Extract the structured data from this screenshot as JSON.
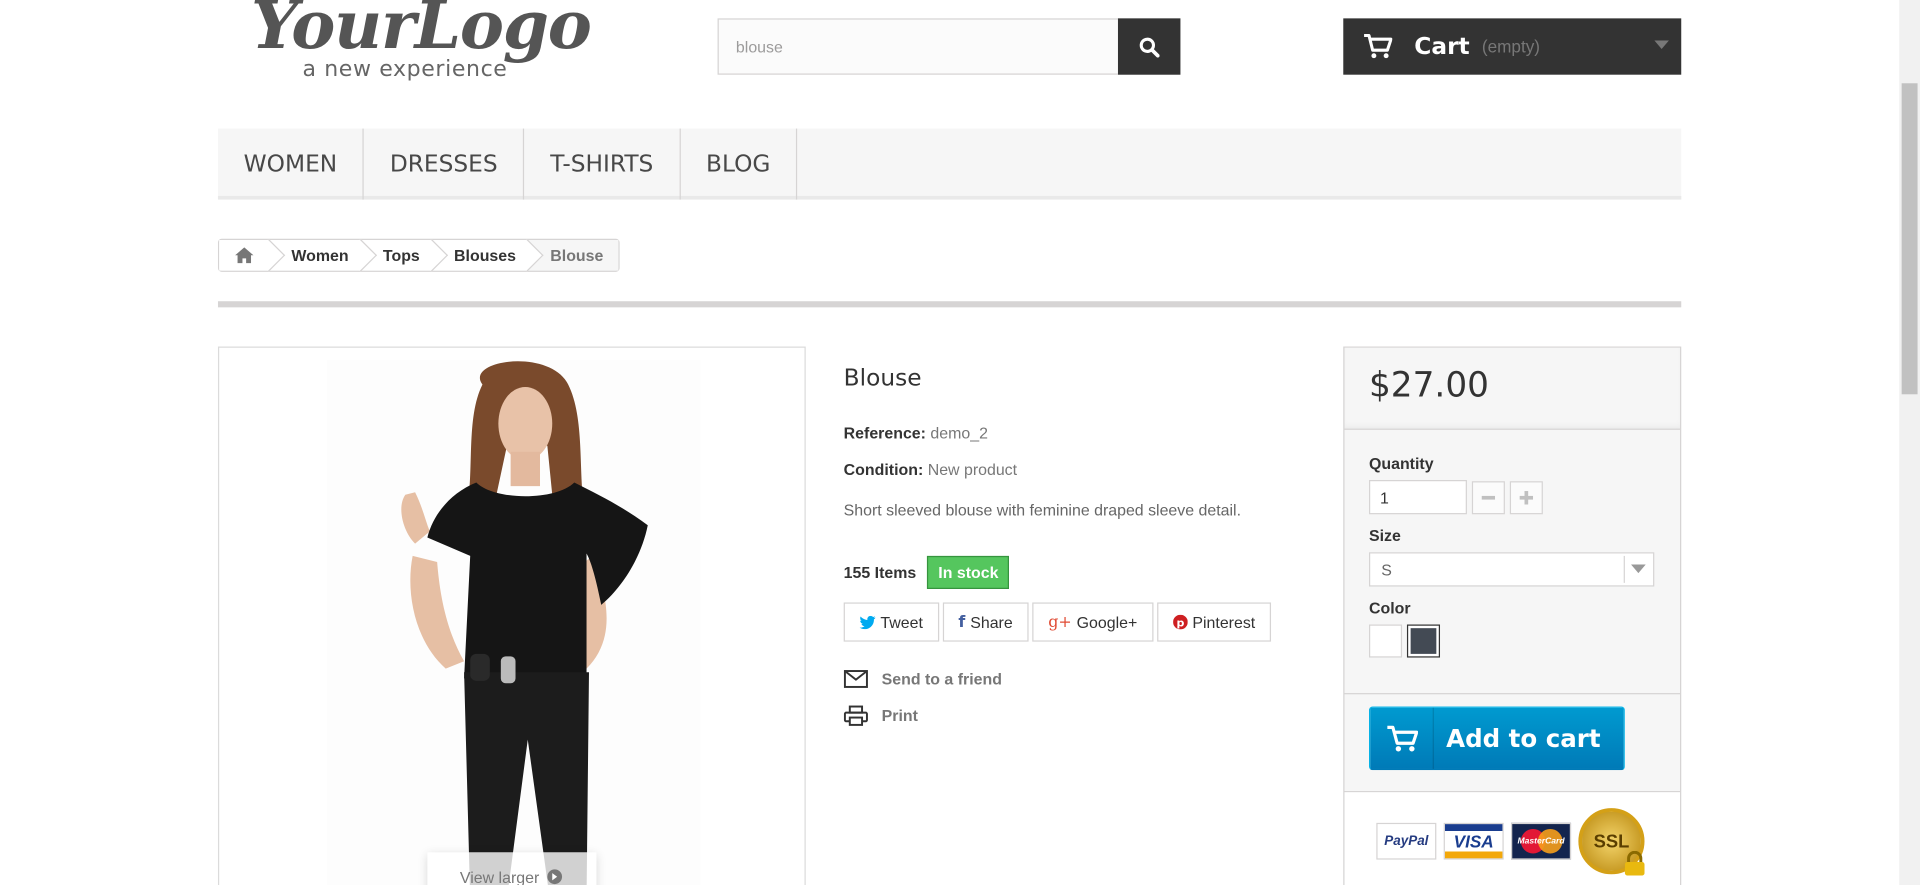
{
  "header": {
    "logo_text": "YourLogo",
    "logo_tagline": "a new experience",
    "search_value": "blouse",
    "cart_label": "Cart",
    "cart_state": "(empty)"
  },
  "menu": {
    "items": [
      {
        "label": "WOMEN"
      },
      {
        "label": "DRESSES"
      },
      {
        "label": "T-SHIRTS"
      },
      {
        "label": "BLOG"
      }
    ]
  },
  "breadcrumb": {
    "items": [
      "Women",
      "Tops",
      "Blouses",
      "Blouse"
    ]
  },
  "product": {
    "view_larger": "View larger",
    "title": "Blouse",
    "reference_label": "Reference:",
    "reference_value": "demo_2",
    "condition_label": "Condition:",
    "condition_value": "New product",
    "description": "Short sleeved blouse with feminine draped sleeve detail.",
    "quantity_available": "155 Items",
    "stock_badge": "In stock",
    "social": {
      "tweet": "Tweet",
      "share": "Share",
      "google": "Google+",
      "pinterest": "Pinterest"
    },
    "send_to_friend": "Send to a friend",
    "print": "Print"
  },
  "buy_box": {
    "price": "$27.00",
    "quantity_label": "Quantity",
    "quantity_value": "1",
    "size_label": "Size",
    "size_value": "S",
    "color_label": "Color",
    "colors": [
      "#ffffff",
      "#434a54"
    ],
    "add_to_cart": "Add to cart",
    "payment_cards": [
      "PayPal",
      "VISA",
      "MasterCard"
    ],
    "ssl_badge": "SSL"
  },
  "colors": {
    "dark": "#333333",
    "stock_green": "#55c65e",
    "add_blue": "#009ad0"
  }
}
